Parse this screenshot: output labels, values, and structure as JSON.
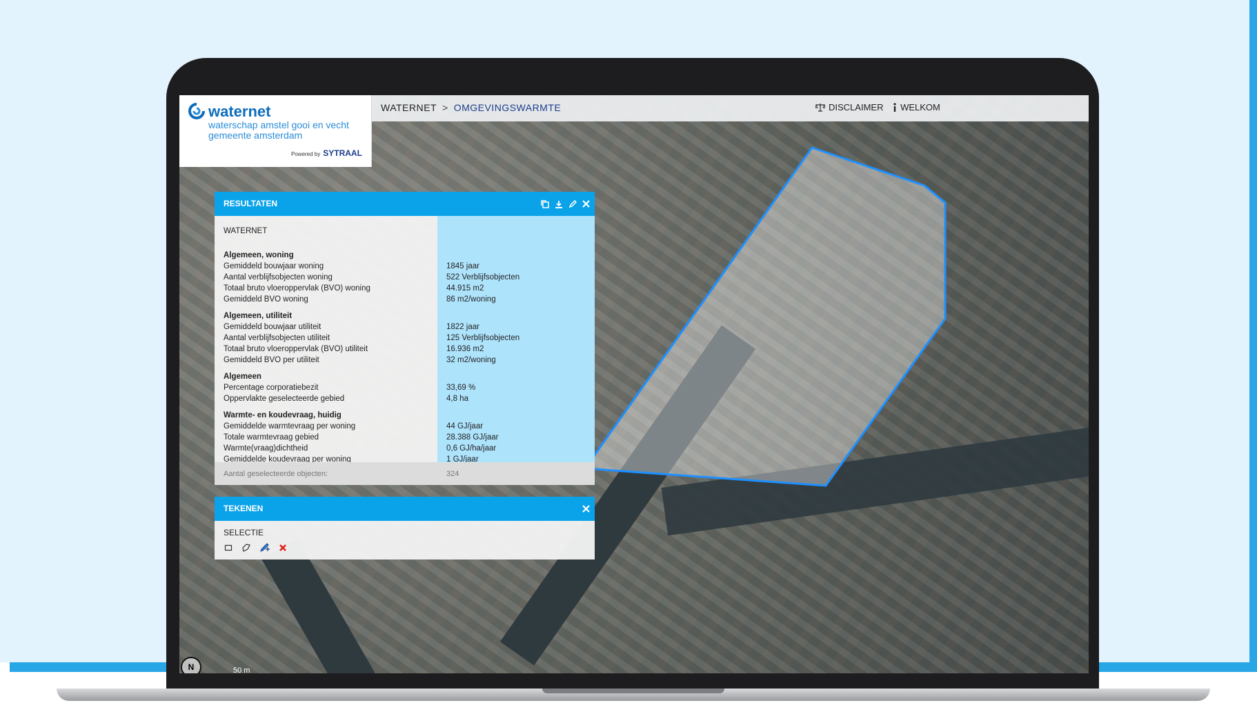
{
  "header": {
    "breadcrumb": [
      "WATERNET",
      "OMGEVINGSWARMTE"
    ],
    "breadcrumb_separator": ">",
    "links": [
      {
        "label": "DISCLAIMER",
        "icon": "scale-icon"
      },
      {
        "label": "WELKOM",
        "icon": "info-icon"
      }
    ]
  },
  "logo": {
    "brand": "waternet",
    "subtitle_line1": "waterschap amstel gooi en vecht",
    "subtitle_line2": "gemeente amsterdam",
    "powered_by": "Powered by",
    "powered_brand": "SYTRAAL"
  },
  "resultaten": {
    "title": "RESULTATEN",
    "tools": [
      "copy-icon",
      "download-icon",
      "edit-icon",
      "close-icon"
    ],
    "heading": "WATERNET",
    "sections": [
      {
        "title": "Algemeen, woning",
        "rows": [
          {
            "label": "Gemiddeld bouwjaar woning",
            "value": "1845 jaar"
          },
          {
            "label": "Aantal verblijfsobjecten woning",
            "value": "522 Verblijfsobjecten"
          },
          {
            "label": "Totaal bruto vloeroppervlak (BVO) woning",
            "value": "44.915 m2"
          },
          {
            "label": "Gemiddeld BVO woning",
            "value": "86 m2/woning"
          }
        ]
      },
      {
        "title": "Algemeen, utiliteit",
        "rows": [
          {
            "label": "Gemiddeld bouwjaar utiliteit",
            "value": "1822 jaar"
          },
          {
            "label": "Aantal verblijfsobjecten utiliteit",
            "value": "125 Verblijfsobjecten"
          },
          {
            "label": "Totaal bruto vloeroppervlak (BVO) utiliteit",
            "value": "16.936 m2"
          },
          {
            "label": "Gemiddeld BVO per utiliteit",
            "value": "32 m2/woning"
          }
        ]
      },
      {
        "title": "Algemeen",
        "rows": [
          {
            "label": "Percentage corporatiebezit",
            "value": "33,69 %"
          },
          {
            "label": "Oppervlakte geselecteerde gebied",
            "value": "4,8 ha"
          }
        ]
      },
      {
        "title": "Warmte- en koudevraag, huidig",
        "rows": [
          {
            "label": "",
            "value": ""
          },
          {
            "label": "Gemiddelde warmtevraag per woning",
            "value": "44 GJ/jaar"
          },
          {
            "label": "Totale warmtevraag gebied",
            "value": "28.388 GJ/jaar"
          },
          {
            "label": "Warmte(vraag)dichtheid",
            "value": "0,6 GJ/ha/jaar"
          },
          {
            "label": "Gemiddelde koudevraag per woning",
            "value": "1 GJ/jaar"
          }
        ]
      }
    ],
    "footer_label": "Aantal geselecteerde objecten:",
    "footer_value": "324"
  },
  "tekenen": {
    "title": "TEKENEN",
    "section": "SELECTIE",
    "tools": [
      "rectangle-select-icon",
      "polygon-select-icon",
      "edit-select-icon",
      "delete-select-icon"
    ]
  },
  "map": {
    "scale_label": "50 m",
    "north_label": "N",
    "selection_color": "#1e90ff"
  }
}
